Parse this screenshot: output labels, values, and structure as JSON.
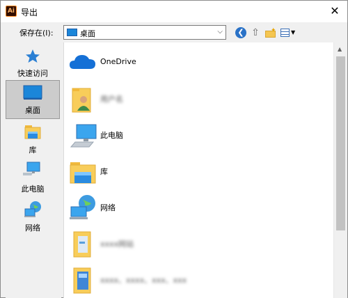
{
  "window": {
    "title": "导出",
    "app_icon_text": "Ai",
    "close_glyph": "✕"
  },
  "toolbar": {
    "save_in_label": "保存在(I):",
    "location_value": "桌面",
    "combo_chevron": "⌵",
    "back_glyph": "❮",
    "up_glyph": "⇧",
    "new_folder_glyph": "✦",
    "view_menu_glyph": "▼"
  },
  "places_bar": [
    {
      "label": "快速访问",
      "icon": "quick-access-star-icon",
      "selected": false
    },
    {
      "label": "桌面",
      "icon": "desktop-icon",
      "selected": true
    },
    {
      "label": "库",
      "icon": "library-icon",
      "selected": false
    },
    {
      "label": "此电脑",
      "icon": "this-pc-icon",
      "selected": false
    },
    {
      "label": "网络",
      "icon": "network-icon",
      "selected": false
    }
  ],
  "file_list": [
    {
      "label": "OneDrive",
      "icon": "onedrive-cloud-icon",
      "blurred": false
    },
    {
      "label": "用户名",
      "icon": "user-folder-icon",
      "blurred": true
    },
    {
      "label": "此电脑",
      "icon": "this-pc-icon",
      "blurred": false
    },
    {
      "label": "库",
      "icon": "library-icon",
      "blurred": false
    },
    {
      "label": "网络",
      "icon": "network-icon",
      "blurred": false
    },
    {
      "label": "xxxx网站",
      "icon": "folder-icon",
      "blurred": true
    },
    {
      "label": "xxxx、xxxx、xxx、xxx",
      "icon": "folder-icon",
      "blurred": true
    }
  ],
  "scrollbar": {
    "up_glyph": "▲"
  },
  "colors": {
    "accent_blue": "#1b86d9",
    "folder_yellow": "#f8cd5a",
    "selection_gray": "#cccccc",
    "ai_brand": "#ff8a1a"
  }
}
